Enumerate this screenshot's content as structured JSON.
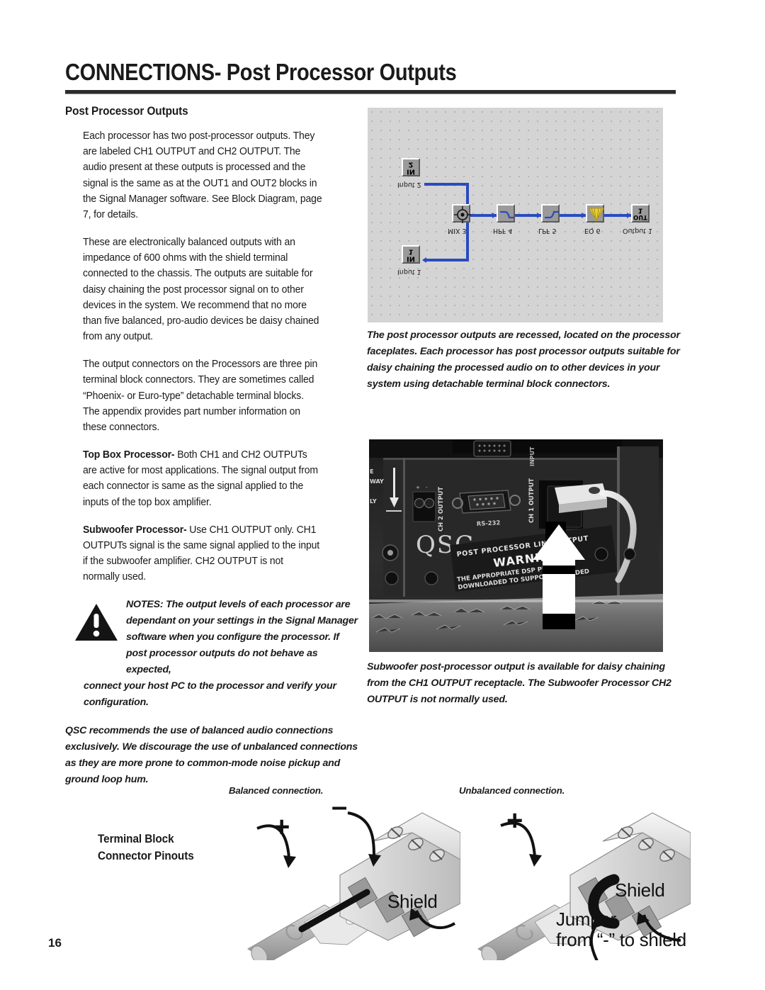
{
  "header": {
    "title_bold": "CONNECTIONS-",
    "title_rest": " Post Processor Outputs"
  },
  "left_column": {
    "subheading": "Post Processor Outputs",
    "paragraphs": [
      "Each processor has two post-processor outputs. They are labeled CH1 OUTPUT and CH2 OUTPUT. The audio present at these outputs is processed and the signal is the same as at the OUT1 and OUT2 blocks in the Signal Manager software. See Block Diagram, page 7, for details.",
      "These are electronically balanced outputs with an impedance of 600 ohms with the shield terminal connected to the chassis. The outputs are suitable for daisy chaining the post processor signal on to other devices in the system. We recommend that no more than five balanced, pro-audio devices be daisy chained from any output.",
      "The output connectors on the Processors are three pin terminal block connectors. They are sometimes called “Phoenix- or Euro-type” detachable terminal blocks. The appendix provides part number information on these connectors."
    ],
    "top_box": {
      "lead": "Top Box Processor-",
      "text": " Both CH1 and CH2 OUTPUTs are active for most applications. The signal output from each connector is same as the signal applied to the inputs of the top box amplifier."
    },
    "subwoofer": {
      "lead": "Subwoofer Processor-",
      "text": " Use CH1 OUTPUT only. CH1 OUTPUTs signal is the same signal applied to the input if the subwoofer amplifier. CH2 OUTPUT is not normally used."
    },
    "notes": {
      "indented": "NOTES: The output levels of each processor are dependant on your settings in the Signal Manager software  when you configure the processor. If post processor outputs do not behave as expected,",
      "full_width": "connect your host PC to the processor and verify your configuration."
    },
    "qsc_note": "QSC recommends the use of balanced audio connections exclusively. We discourage the use of unbalanced connections as they are more prone to common-mode noise pickup and ground loop hum."
  },
  "diagram": {
    "blocks": [
      {
        "label": "Input 2",
        "inner": "IN\n2"
      },
      {
        "label": "Input 1",
        "inner": "IN\n1"
      },
      {
        "label": "MIX 3",
        "inner": ""
      },
      {
        "label": "HPF 4",
        "inner": ""
      },
      {
        "label": "LPF 5",
        "inner": ""
      },
      {
        "label": "EQ 6",
        "inner": ""
      },
      {
        "label": "Output 1",
        "inner": "OUT\n1"
      }
    ],
    "in2_line1": "IN",
    "in2_line2": "2",
    "in1_line1": "IN",
    "in1_line2": "1",
    "out_line1": "OUT",
    "out_line2": "1",
    "label_in2": "Input 2",
    "label_in1": "Input 1",
    "label_mix": "MIX 3",
    "label_hpf": "HPF 4",
    "label_lpf": "LPF 5",
    "label_eq": "EQ 6",
    "label_out": "Output 1",
    "wire_color": "#2a4bbf",
    "background_color": "#d4d4d4"
  },
  "captions": {
    "diagram_caption": "The post processor outputs are recessed, located on the processor faceplates. Each processor has post processor outputs suitable for daisy chaining the processed audio on to other devices in your system using detachable terminal block connectors.",
    "photo_caption": "Subwoofer  post-processor output is available for daisy chaining from the CH1  OUTPUT  receptacle. The Subwoofer Processor CH2 OUTPUT is not normally used."
  },
  "photo": {
    "brand": "QSC",
    "label_line": "POST PROCESSOR LINE OUTPUT",
    "warning": "WARNING",
    "warning_body_1": "THE APPROPRIATE DSP PROGRAM",
    "warning_body_2": "DOWNLOADED TO SUPPORT INTENDED",
    "port_ch2": "CH 2 OUTPUT",
    "port_ch1": "CH 1 OUTPUT",
    "port_rs232": "RS-232",
    "port_input": "INPUT",
    "side_1": "E",
    "side_2": "WAY",
    "side_3": "LY"
  },
  "pinouts": {
    "title_line1": "Terminal Block",
    "title_line2": "Connector Pinouts",
    "balanced_label": "Balanced connection.",
    "unbalanced_label": "Unbalanced connection.",
    "plus": "+",
    "minus": "–",
    "shield_left": "Shield",
    "shield_right": "Shield",
    "jumper_line1": "Jumper",
    "jumper_line2": "from “-” to shield"
  },
  "footer": {
    "page_number": "16"
  }
}
